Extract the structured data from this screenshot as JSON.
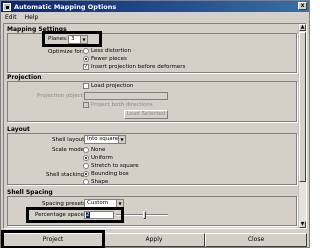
{
  "window": {
    "title": "Automatic Mapping Options",
    "close_glyph": "x"
  },
  "menu": {
    "items": [
      "Edit",
      "Help"
    ]
  },
  "mapping_settings": {
    "header": "Mapping Settings",
    "planes_label": "Planes:",
    "planes_value": "3",
    "optimize_label": "Optimize for:",
    "optimize_options": [
      "Less distortion",
      "Fewer pieces"
    ],
    "optimize_selected": 1,
    "insert_projection_label": "Insert projection before deformers",
    "insert_projection_checked": true
  },
  "projection": {
    "header": "Projection",
    "load_projection_label": "Load projection",
    "projection_object_label": "Projection object:",
    "projection_object_value": "",
    "project_both_directions_label": "Project both directions",
    "load_selected_label": "Load Selected"
  },
  "layout": {
    "header": "Layout",
    "shell_layout_label": "Shell layout:",
    "shell_layout_value": "Into square",
    "scale_mode_label": "Scale mode:",
    "scale_mode_options": [
      "None",
      "Uniform",
      "Stretch to square"
    ],
    "scale_mode_selected": 1,
    "shell_stacking_label": "Shell stacking:",
    "shell_stacking_options": [
      "Bounding box",
      "Shape"
    ],
    "shell_stacking_selected": 0
  },
  "shell_spacing": {
    "header": "Shell Spacing",
    "spacing_presets_label": "Spacing presets:",
    "spacing_presets_value": "Custom",
    "percentage_space_label": "Percentage space:",
    "percentage_space_value": "2",
    "percentage_space_fraction": 0.02
  },
  "footer": {
    "project_label": "Project",
    "apply_label": "Apply",
    "close_label": "Close"
  }
}
